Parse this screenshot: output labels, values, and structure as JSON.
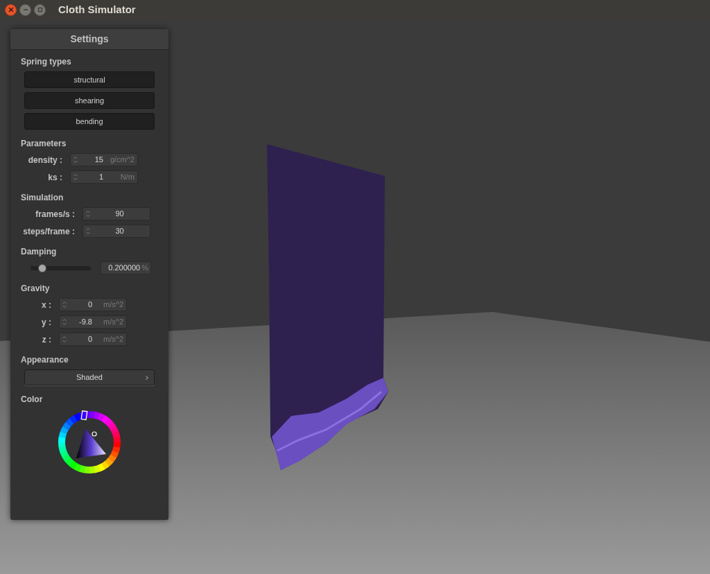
{
  "window": {
    "title": "Cloth Simulator"
  },
  "panel": {
    "title": "Settings",
    "sections": [
      {
        "kind": "buttons",
        "title": "Spring types",
        "buttons": [
          "structural",
          "shearing",
          "bending"
        ]
      },
      {
        "kind": "fields",
        "title": "Parameters",
        "fields": [
          {
            "label": "density :",
            "value": "15",
            "unit": "g/cm^2"
          },
          {
            "label": "ks :",
            "value": "1",
            "unit": "N/m"
          }
        ]
      },
      {
        "kind": "fields",
        "title": "Simulation",
        "fields": [
          {
            "label": "frames/s :",
            "value": "90"
          },
          {
            "label": "steps/frame :",
            "value": "30"
          }
        ]
      },
      {
        "kind": "slider",
        "title": "Damping",
        "level": 0.2,
        "value": "0.200000",
        "unit": "%"
      },
      {
        "kind": "fields",
        "title": "Gravity",
        "fields": [
          {
            "label": "x :",
            "value": "0",
            "unit": "m/s^2"
          },
          {
            "label": "y :",
            "value": "-9.8",
            "unit": "m/s^2"
          },
          {
            "label": "z :",
            "value": "0",
            "unit": "m/s^2"
          }
        ]
      },
      {
        "kind": "dropdown",
        "title": "Appearance",
        "value": "Shaded"
      },
      {
        "kind": "color_wheel",
        "title": "Color"
      }
    ]
  }
}
